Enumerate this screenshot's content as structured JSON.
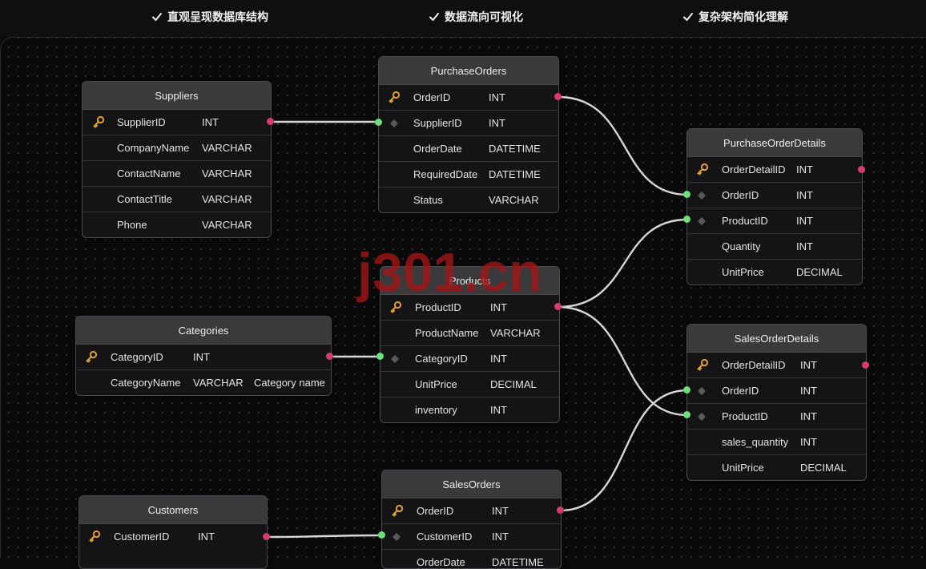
{
  "features": [
    {
      "label": "直观呈现数据库结构"
    },
    {
      "label": "数据流向可视化"
    },
    {
      "label": "复杂架构简化理解"
    }
  ],
  "watermark": "j301.cn",
  "colors": {
    "background": "#0a0a0a",
    "table_header": "#3a3a3d",
    "primary_key_port": "#d63b6c",
    "foreign_key_port": "#6ee07a",
    "key_icon": "#e3a02c",
    "connector": "#d7d7d7"
  },
  "tables": {
    "suppliers": {
      "title": "Suppliers",
      "rows": [
        {
          "name": "SupplierID",
          "type": "INT",
          "key": "primary"
        },
        {
          "name": "CompanyName",
          "type": "VARCHAR"
        },
        {
          "name": "ContactName",
          "type": "VARCHAR"
        },
        {
          "name": "ContactTitle",
          "type": "VARCHAR"
        },
        {
          "name": "Phone",
          "type": "VARCHAR"
        }
      ]
    },
    "purchase_orders": {
      "title": "PurchaseOrders",
      "rows": [
        {
          "name": "OrderID",
          "type": "INT",
          "key": "primary"
        },
        {
          "name": "SupplierID",
          "type": "INT",
          "key": "foreign"
        },
        {
          "name": "OrderDate",
          "type": "DATETIME"
        },
        {
          "name": "RequiredDate",
          "type": "DATETIME"
        },
        {
          "name": "Status",
          "type": "VARCHAR"
        }
      ]
    },
    "purchase_order_details": {
      "title": "PurchaseOrderDetails",
      "rows": [
        {
          "name": "OrderDetailID",
          "type": "INT",
          "key": "primary"
        },
        {
          "name": "OrderID",
          "type": "INT",
          "key": "foreign"
        },
        {
          "name": "ProductID",
          "type": "INT",
          "key": "foreign"
        },
        {
          "name": "Quantity",
          "type": "INT"
        },
        {
          "name": "UnitPrice",
          "type": "DECIMAL"
        }
      ]
    },
    "products": {
      "title": "Products",
      "rows": [
        {
          "name": "ProductID",
          "type": "INT",
          "key": "primary"
        },
        {
          "name": "ProductName",
          "type": "VARCHAR"
        },
        {
          "name": "CategoryID",
          "type": "INT",
          "key": "foreign"
        },
        {
          "name": "UnitPrice",
          "type": "DECIMAL"
        },
        {
          "name": "inventory",
          "type": "INT"
        }
      ]
    },
    "categories": {
      "title": "Categories",
      "rows": [
        {
          "name": "CategoryID",
          "type": "INT",
          "key": "primary"
        },
        {
          "name": "CategoryName",
          "type": "VARCHAR",
          "note": "Category name"
        }
      ]
    },
    "sales_order_details": {
      "title": "SalesOrderDetails",
      "rows": [
        {
          "name": "OrderDetailID",
          "type": "INT",
          "key": "primary"
        },
        {
          "name": "OrderID",
          "type": "INT",
          "key": "foreign"
        },
        {
          "name": "ProductID",
          "type": "INT",
          "key": "foreign"
        },
        {
          "name": "sales_quantity",
          "type": "INT"
        },
        {
          "name": "UnitPrice",
          "type": "DECIMAL"
        }
      ]
    },
    "customers": {
      "title": "Customers",
      "rows": [
        {
          "name": "CustomerID",
          "type": "INT",
          "key": "primary"
        }
      ]
    },
    "sales_orders": {
      "title": "SalesOrders",
      "rows": [
        {
          "name": "OrderID",
          "type": "INT",
          "key": "primary"
        },
        {
          "name": "CustomerID",
          "type": "INT",
          "key": "foreign"
        },
        {
          "name": "OrderDate",
          "type": "DATETIME"
        }
      ]
    }
  },
  "relationships": [
    {
      "from": "Suppliers.SupplierID",
      "to": "PurchaseOrders.SupplierID"
    },
    {
      "from": "PurchaseOrders.OrderID",
      "to": "PurchaseOrderDetails.OrderID"
    },
    {
      "from": "Products.ProductID",
      "to": "PurchaseOrderDetails.ProductID"
    },
    {
      "from": "Products.ProductID",
      "to": "SalesOrderDetails.ProductID"
    },
    {
      "from": "Categories.CategoryID",
      "to": "Products.CategoryID"
    },
    {
      "from": "SalesOrders.OrderID",
      "to": "SalesOrderDetails.OrderID"
    },
    {
      "from": "Customers.CustomerID",
      "to": "SalesOrders.CustomerID"
    }
  ]
}
